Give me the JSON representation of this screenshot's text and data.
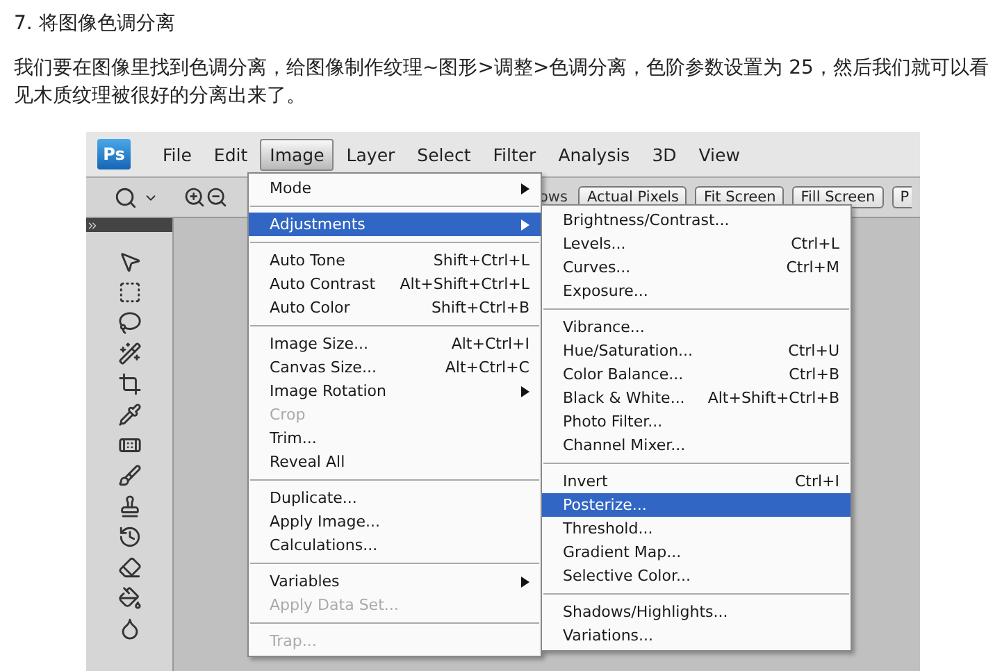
{
  "heading": "7. 将图像色调分离",
  "paragraph": "我们要在图像里找到色调分离，给图像制作纹理~图形>调整>色调分离，色阶参数设置为 25，然后我们就可以看见木质纹理被很好的分离出来了。",
  "app": {
    "logo": "Ps",
    "menubar": [
      {
        "label": "File",
        "selected": false
      },
      {
        "label": "Edit",
        "selected": false
      },
      {
        "label": "Image",
        "selected": true
      },
      {
        "label": "Layer",
        "selected": false
      },
      {
        "label": "Select",
        "selected": false
      },
      {
        "label": "Filter",
        "selected": false
      },
      {
        "label": "Analysis",
        "selected": false
      },
      {
        "label": "3D",
        "selected": false
      },
      {
        "label": "View",
        "selected": false
      }
    ],
    "options_bar": {
      "partial_label": "ows",
      "buttons": [
        "Actual Pixels",
        "Fit Screen",
        "Fill Screen",
        "P"
      ]
    },
    "image_menu": [
      {
        "kind": "item",
        "label": "Mode",
        "submenu": true,
        "selected": false,
        "disabled": false
      },
      {
        "kind": "separator"
      },
      {
        "kind": "item",
        "label": "Adjustments",
        "submenu": true,
        "selected": true,
        "disabled": false
      },
      {
        "kind": "separator"
      },
      {
        "kind": "item",
        "label": "Auto Tone",
        "shortcut": "Shift+Ctrl+L",
        "selected": false,
        "disabled": false
      },
      {
        "kind": "item",
        "label": "Auto Contrast",
        "shortcut": "Alt+Shift+Ctrl+L",
        "selected": false,
        "disabled": false
      },
      {
        "kind": "item",
        "label": "Auto Color",
        "shortcut": "Shift+Ctrl+B",
        "selected": false,
        "disabled": false
      },
      {
        "kind": "separator"
      },
      {
        "kind": "item",
        "label": "Image Size...",
        "shortcut": "Alt+Ctrl+I",
        "selected": false,
        "disabled": false
      },
      {
        "kind": "item",
        "label": "Canvas Size...",
        "shortcut": "Alt+Ctrl+C",
        "selected": false,
        "disabled": false
      },
      {
        "kind": "item",
        "label": "Image Rotation",
        "submenu": true,
        "selected": false,
        "disabled": false
      },
      {
        "kind": "item",
        "label": "Crop",
        "selected": false,
        "disabled": true
      },
      {
        "kind": "item",
        "label": "Trim...",
        "selected": false,
        "disabled": false
      },
      {
        "kind": "item",
        "label": "Reveal All",
        "selected": false,
        "disabled": false
      },
      {
        "kind": "separator"
      },
      {
        "kind": "item",
        "label": "Duplicate...",
        "selected": false,
        "disabled": false
      },
      {
        "kind": "item",
        "label": "Apply Image...",
        "selected": false,
        "disabled": false
      },
      {
        "kind": "item",
        "label": "Calculations...",
        "selected": false,
        "disabled": false
      },
      {
        "kind": "separator"
      },
      {
        "kind": "item",
        "label": "Variables",
        "submenu": true,
        "selected": false,
        "disabled": false
      },
      {
        "kind": "item",
        "label": "Apply Data Set...",
        "selected": false,
        "disabled": true
      },
      {
        "kind": "separator"
      },
      {
        "kind": "item",
        "label": "Trap...",
        "selected": false,
        "disabled": true
      }
    ],
    "adjustments_menu": [
      {
        "kind": "item",
        "label": "Brightness/Contrast...",
        "selected": false
      },
      {
        "kind": "item",
        "label": "Levels...",
        "shortcut": "Ctrl+L",
        "selected": false
      },
      {
        "kind": "item",
        "label": "Curves...",
        "shortcut": "Ctrl+M",
        "selected": false
      },
      {
        "kind": "item",
        "label": "Exposure...",
        "selected": false
      },
      {
        "kind": "separator"
      },
      {
        "kind": "item",
        "label": "Vibrance...",
        "selected": false
      },
      {
        "kind": "item",
        "label": "Hue/Saturation...",
        "shortcut": "Ctrl+U",
        "selected": false
      },
      {
        "kind": "item",
        "label": "Color Balance...",
        "shortcut": "Ctrl+B",
        "selected": false
      },
      {
        "kind": "item",
        "label": "Black & White...",
        "shortcut": "Alt+Shift+Ctrl+B",
        "selected": false
      },
      {
        "kind": "item",
        "label": "Photo Filter...",
        "selected": false
      },
      {
        "kind": "item",
        "label": "Channel Mixer...",
        "selected": false
      },
      {
        "kind": "separator"
      },
      {
        "kind": "item",
        "label": "Invert",
        "shortcut": "Ctrl+I",
        "selected": false
      },
      {
        "kind": "item",
        "label": "Posterize...",
        "selected": true
      },
      {
        "kind": "item",
        "label": "Threshold...",
        "selected": false
      },
      {
        "kind": "item",
        "label": "Gradient Map...",
        "selected": false
      },
      {
        "kind": "item",
        "label": "Selective Color...",
        "selected": false
      },
      {
        "kind": "separator"
      },
      {
        "kind": "item",
        "label": "Shadows/Highlights...",
        "selected": false
      },
      {
        "kind": "item",
        "label": "Variations...",
        "selected": false
      }
    ]
  }
}
